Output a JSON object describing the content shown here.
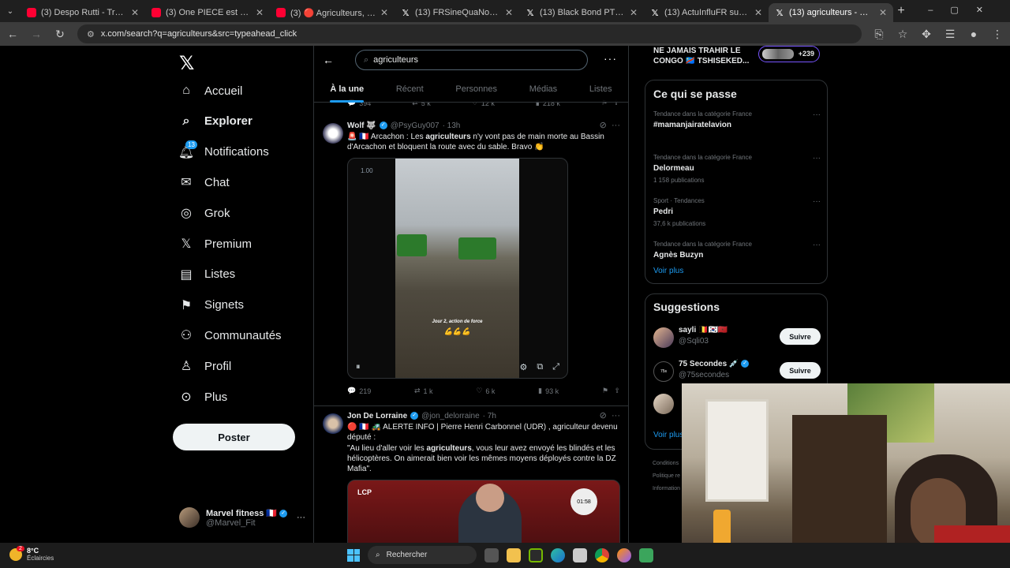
{
  "browser": {
    "tabs": [
      {
        "title": "(3) Despo Rutti - Trashhh - You",
        "type": "yt"
      },
      {
        "title": "(3) One PIECE est meilleur sans",
        "type": "yt"
      },
      {
        "title": "(3) 🔴 Agriculteurs, vote du bu",
        "type": "yt"
      },
      {
        "title": "(13) FRSineQuaNon sur X : \"@1",
        "type": "x"
      },
      {
        "title": "(13) Black Bond PTV sur X : \"De",
        "type": "x"
      },
      {
        "title": "(13) ActuInfluFR sur X : \"Mais v",
        "type": "x"
      },
      {
        "title": "(13) agriculteurs - Recherch",
        "type": "x",
        "active": true
      }
    ],
    "url": "x.com/search?q=agriculteurs&src=typeahead_click"
  },
  "nav": {
    "items": [
      {
        "label": "Accueil",
        "icon": "home-icon"
      },
      {
        "label": "Explorer",
        "icon": "search-icon",
        "bold": true
      },
      {
        "label": "Notifications",
        "icon": "bell-icon",
        "badge": "13"
      },
      {
        "label": "Chat",
        "icon": "mail-icon"
      },
      {
        "label": "Grok",
        "icon": "grok-icon"
      },
      {
        "label": "Premium",
        "icon": "x-logo-icon"
      },
      {
        "label": "Listes",
        "icon": "list-icon"
      },
      {
        "label": "Signets",
        "icon": "bookmark-icon"
      },
      {
        "label": "Communautés",
        "icon": "people-icon"
      },
      {
        "label": "Profil",
        "icon": "person-icon"
      },
      {
        "label": "Plus",
        "icon": "more-circle-icon"
      }
    ],
    "post_label": "Poster",
    "account": {
      "name": "Marvel fitness 🇫🇷",
      "handle": "@Marvel_Fit"
    }
  },
  "search": {
    "query": "agriculteurs",
    "tabs": [
      "À la une",
      "Récent",
      "Personnes",
      "Médias",
      "Listes"
    ],
    "active_tab": "À la une"
  },
  "prev_tweet": {
    "replies": "394",
    "reposts": "5 k",
    "likes": "12 k",
    "views": "218 k"
  },
  "tweets": [
    {
      "name": "Wolf 🐺",
      "handle": "@PsyGuy007",
      "time": "· 13h",
      "text_parts": [
        "🚨 🇫🇷 Arcachon : Les ",
        "agriculteurs",
        " n'y vont pas de main morte au Bassin d'Arcachon et bloquent la route avec du sable. Bravo 👏"
      ],
      "video": {
        "speed": "1.00",
        "caption": "Jour 2, action de force",
        "emoji": "💪💪💪"
      },
      "replies": "219",
      "reposts": "1 k",
      "likes": "6 k",
      "views": "93 k"
    },
    {
      "name": "Jon De Lorraine",
      "handle": "@jon_delorraine",
      "time": "· 7h",
      "line1": "🔴 🇫🇷 🚜 ALERTE INFO | Pierre Henri Carbonnel (UDR) , agriculteur devenu député :",
      "quote_parts": [
        "\"Au lieu d'aller voir les ",
        "agriculteurs",
        ", vous leur avez envoyé les blindés et les hélicoptères. On aimerait bien voir les mêmes moyens déployés contre la DZ Mafia\"."
      ],
      "media_label": "LCP",
      "timer": "01:58"
    }
  ],
  "right": {
    "top_trend": {
      "line1": "NE JAMAIS TRAHIR LE",
      "line2": "CONGO 🇨🇩 TSHISEKED...",
      "count": "+239"
    },
    "happening_title": "Ce qui se passe",
    "trends": [
      {
        "cat": "Tendance dans la catégorie France",
        "name": "#mamanjairatelavion",
        "count": ""
      },
      {
        "cat": "Tendance dans la catégorie France",
        "name": "Delormeau",
        "count": "1 158 publications"
      },
      {
        "cat": "Sport · Tendances",
        "name": "Pedri",
        "count": "37,6 k publications"
      },
      {
        "cat": "Tendance dans la catégorie France",
        "name": "Agnès Buzyn",
        "count": ""
      }
    ],
    "see_more": "Voir plus",
    "suggestions_title": "Suggestions",
    "suggestions": [
      {
        "name": "sayli 🇧🇪🇰🇷🇲🇦",
        "handle": "@Sqli03",
        "follow": "Suivre"
      },
      {
        "name": "75 Secondes 💉",
        "handle": "@75secondes",
        "follow": "Suivre"
      }
    ],
    "see_more2": "Voir plus",
    "footer": [
      "Conditions",
      "Politique re",
      "Information"
    ]
  },
  "taskbar": {
    "temp": "8°C",
    "weather": "Éclaircies",
    "weather_badge": "2",
    "search": "Rechercher"
  },
  "colors": {
    "accent": "#1d9bf0",
    "bg": "#000000",
    "border": "#2f3336",
    "muted": "#71767b"
  }
}
